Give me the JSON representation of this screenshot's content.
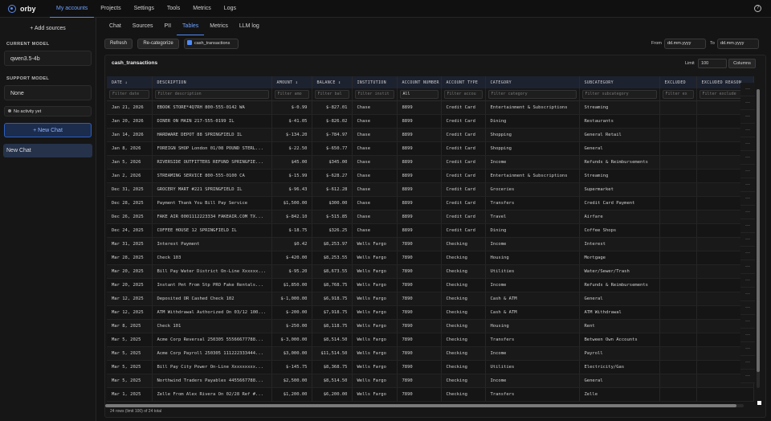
{
  "app": {
    "name": "orby"
  },
  "nav": {
    "items": [
      "My accounts",
      "Projects",
      "Settings",
      "Tools",
      "Metrics",
      "Logs"
    ],
    "active": "My accounts"
  },
  "sidebar": {
    "add_sources": "+ Add sources",
    "current_model_label": "CURRENT MODEL",
    "current_model": "qwen3.5-4b",
    "support_model_label": "SUPPORT MODEL",
    "support_model": "None",
    "activity": "No activity yet",
    "new_chat": "New Chat",
    "chats": [
      "New Chat"
    ]
  },
  "tabs": {
    "items": [
      "Chat",
      "Sources",
      "PII",
      "Tables",
      "Metrics",
      "LLM log"
    ],
    "active": "Tables"
  },
  "toolbar": {
    "refresh": "Refresh",
    "recategorize": "Re-categorize",
    "checkbox_label": "cash_transactions",
    "from_label": "From",
    "from_value": "dd.mm.yyyy",
    "to_label": "To",
    "to_value": "dd.mm.yyyy"
  },
  "table": {
    "name": "cash_transactions",
    "limit_label": "Limit",
    "limit_value": "100",
    "columns_button": "Columns",
    "headers": [
      "DATE ↓",
      "DESCRIPTION",
      "AMOUNT ↕",
      "BALANCE ↕",
      "INSTITUTION",
      "ACCOUNT NUMBER",
      "ACCOUNT TYPE",
      "CATEGORY",
      "SUBCATEGORY",
      "EXCLUDED",
      "EXCLUDED REASON"
    ],
    "filters": [
      "Filter date",
      "Filter description",
      "Filter amo",
      "Filter bal",
      "Filter instit",
      "All",
      "Filter accou",
      "Filter category",
      "Filter subcategory",
      "Filter ex",
      "Filter exclude"
    ],
    "rows": [
      [
        "Jan 21, 2026",
        "EBOOK STORE*4Q7RH 800-555-0142 WA",
        "$-0.99",
        "$-827.01",
        "Chase",
        "8899",
        "Credit Card",
        "Entertainment & Subscriptions",
        "Streaming",
        "",
        ""
      ],
      [
        "Jan 20, 2026",
        "DINER ON MAIN 217-555-0199 IL",
        "$-41.05",
        "$-826.02",
        "Chase",
        "8899",
        "Credit Card",
        "Dining",
        "Restaurants",
        "",
        ""
      ],
      [
        "Jan 14, 2026",
        "HARDWARE DEPOT 88 SPRINGFIELD IL",
        "$-134.20",
        "$-784.97",
        "Chase",
        "8899",
        "Credit Card",
        "Shopping",
        "General Retail",
        "",
        ""
      ],
      [
        "Jan 8, 2026",
        "FOREIGN SHOP London 01/08 POUND STERL...",
        "$-22.50",
        "$-650.77",
        "Chase",
        "8899",
        "Credit Card",
        "Shopping",
        "General",
        "",
        ""
      ],
      [
        "Jan 5, 2026",
        "RIVERSIDE OUTFITTERS REFUND SPRINGFIE...",
        "$45.00",
        "$345.00",
        "Chase",
        "8899",
        "Credit Card",
        "Income",
        "Refunds & Reimbursements",
        "",
        ""
      ],
      [
        "Jan 2, 2026",
        "STREAMING SERVICE 800-555-0100 CA",
        "$-15.99",
        "$-628.27",
        "Chase",
        "8899",
        "Credit Card",
        "Entertainment & Subscriptions",
        "Streaming",
        "",
        ""
      ],
      [
        "Dec 31, 2025",
        "GROCERY MART #221 SPRINGFIELD IL",
        "$-96.43",
        "$-612.28",
        "Chase",
        "8899",
        "Credit Card",
        "Groceries",
        "Supermarket",
        "",
        ""
      ],
      [
        "Dec 28, 2025",
        "Payment Thank You Bill Pay Service",
        "$1,500.00",
        "$300.00",
        "Chase",
        "8899",
        "Credit Card",
        "Transfers",
        "Credit Card Payment",
        "",
        ""
      ],
      [
        "Dec 26, 2025",
        "FAKE AIR 0001112223334 FAKEAIR.COM TX...",
        "$-842.10",
        "$-515.85",
        "Chase",
        "8899",
        "Credit Card",
        "Travel",
        "Airfare",
        "",
        ""
      ],
      [
        "Dec 24, 2025",
        "COFFEE HOUSE 12 SPRINGFIELD IL",
        "$-18.75",
        "$326.25",
        "Chase",
        "8899",
        "Credit Card",
        "Dining",
        "Coffee Shops",
        "",
        ""
      ],
      [
        "Mar 31, 2025",
        "Interest Payment",
        "$0.42",
        "$8,253.97",
        "Wells Fargo",
        "7890",
        "Checking",
        "Income",
        "Interest",
        "",
        ""
      ],
      [
        "Mar 28, 2025",
        "Check 103",
        "$-420.00",
        "$8,253.55",
        "Wells Fargo",
        "7890",
        "Checking",
        "Housing",
        "Mortgage",
        "",
        ""
      ],
      [
        "Mar 20, 2025",
        "Bill Pay Water District On-Line Xxxxxx...",
        "$-95.20",
        "$8,673.55",
        "Wells Fargo",
        "7890",
        "Checking",
        "Utilities",
        "Water/Sewer/Trash",
        "",
        ""
      ],
      [
        "Mar 20, 2025",
        "Instant Pmt From Stp PRO Fake Rentals...",
        "$1,850.00",
        "$8,768.75",
        "Wells Fargo",
        "7890",
        "Checking",
        "Income",
        "Refunds & Reimbursements",
        "",
        ""
      ],
      [
        "Mar 12, 2025",
        "Deposited OR Cashed Check 102",
        "$-1,000.00",
        "$6,918.75",
        "Wells Fargo",
        "7890",
        "Checking",
        "Cash & ATM",
        "General",
        "",
        ""
      ],
      [
        "Mar 12, 2025",
        "ATM Withdrawal Authorized On 03/12 100...",
        "$-200.00",
        "$7,918.75",
        "Wells Fargo",
        "7890",
        "Checking",
        "Cash & ATM",
        "ATM Withdrawal",
        "",
        ""
      ],
      [
        "Mar 8, 2025",
        "Check 101",
        "$-250.00",
        "$8,118.75",
        "Wells Fargo",
        "7890",
        "Checking",
        "Housing",
        "Rent",
        "",
        ""
      ],
      [
        "Mar 5, 2025",
        "Acme Corp Reversal 250305 55566677788...",
        "$-3,000.00",
        "$8,514.50",
        "Wells Fargo",
        "7890",
        "Checking",
        "Transfers",
        "Between Own Accounts",
        "",
        ""
      ],
      [
        "Mar 5, 2025",
        "Acme Corp Payroll 250305 111222333444...",
        "$3,000.00",
        "$11,514.50",
        "Wells Fargo",
        "7890",
        "Checking",
        "Income",
        "Payroll",
        "",
        ""
      ],
      [
        "Mar 5, 2025",
        "Bill Pay City Power On-Line Xxxxxxxxx...",
        "$-145.75",
        "$8,368.75",
        "Wells Fargo",
        "7890",
        "Checking",
        "Utilities",
        "Electricity/Gas",
        "",
        ""
      ],
      [
        "Mar 5, 2025",
        "Northwind Traders Payables 4455667788...",
        "$2,500.00",
        "$8,514.50",
        "Wells Fargo",
        "7890",
        "Checking",
        "Income",
        "General",
        "",
        ""
      ],
      [
        "Mar 1, 2025",
        "Zelle From Alex Rivera On 02/28 Ref #...",
        "$1,200.00",
        "$6,200.00",
        "Wells Fargo",
        "7890",
        "Checking",
        "Transfers",
        "Zelle",
        "",
        ""
      ]
    ],
    "footer": "24 rows (limit 100) of 24 total"
  }
}
